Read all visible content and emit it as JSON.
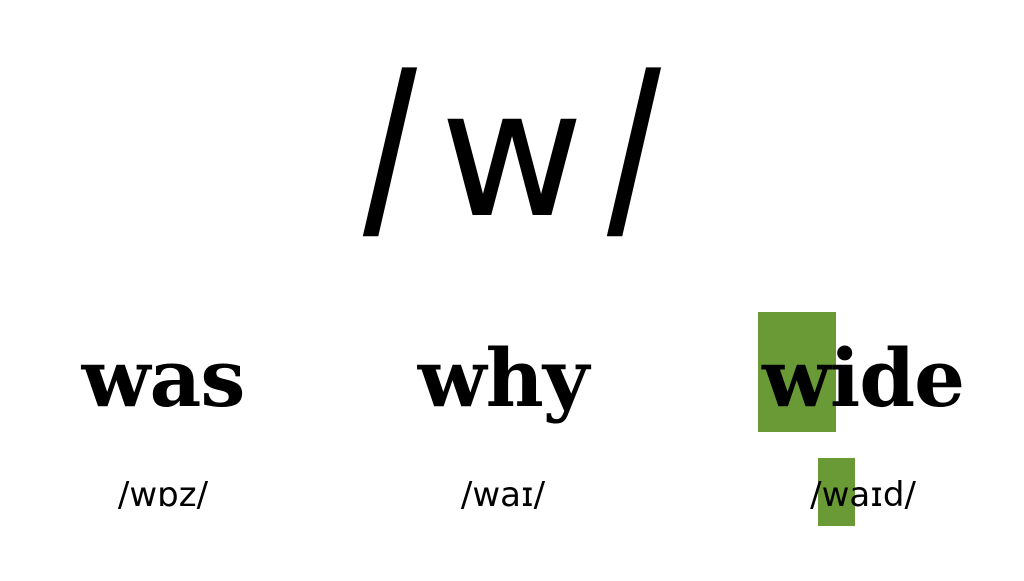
{
  "title": {
    "slash_left": "/",
    "phoneme": "w",
    "slash_right": "/"
  },
  "highlight_color": "#6a9a36",
  "examples": [
    {
      "word_highlight": "",
      "word_rest": "was",
      "ipa_open": "/",
      "ipa_highlight": "",
      "ipa_rest": "wɒz",
      "ipa_close": "/"
    },
    {
      "word_highlight": "",
      "word_rest": "why",
      "ipa_open": "/",
      "ipa_highlight": "",
      "ipa_rest": "waɪ",
      "ipa_close": "/"
    },
    {
      "word_highlight": "w",
      "word_rest": "ide",
      "ipa_open": "/",
      "ipa_highlight": "w",
      "ipa_rest": "aɪd",
      "ipa_close": "/"
    }
  ]
}
